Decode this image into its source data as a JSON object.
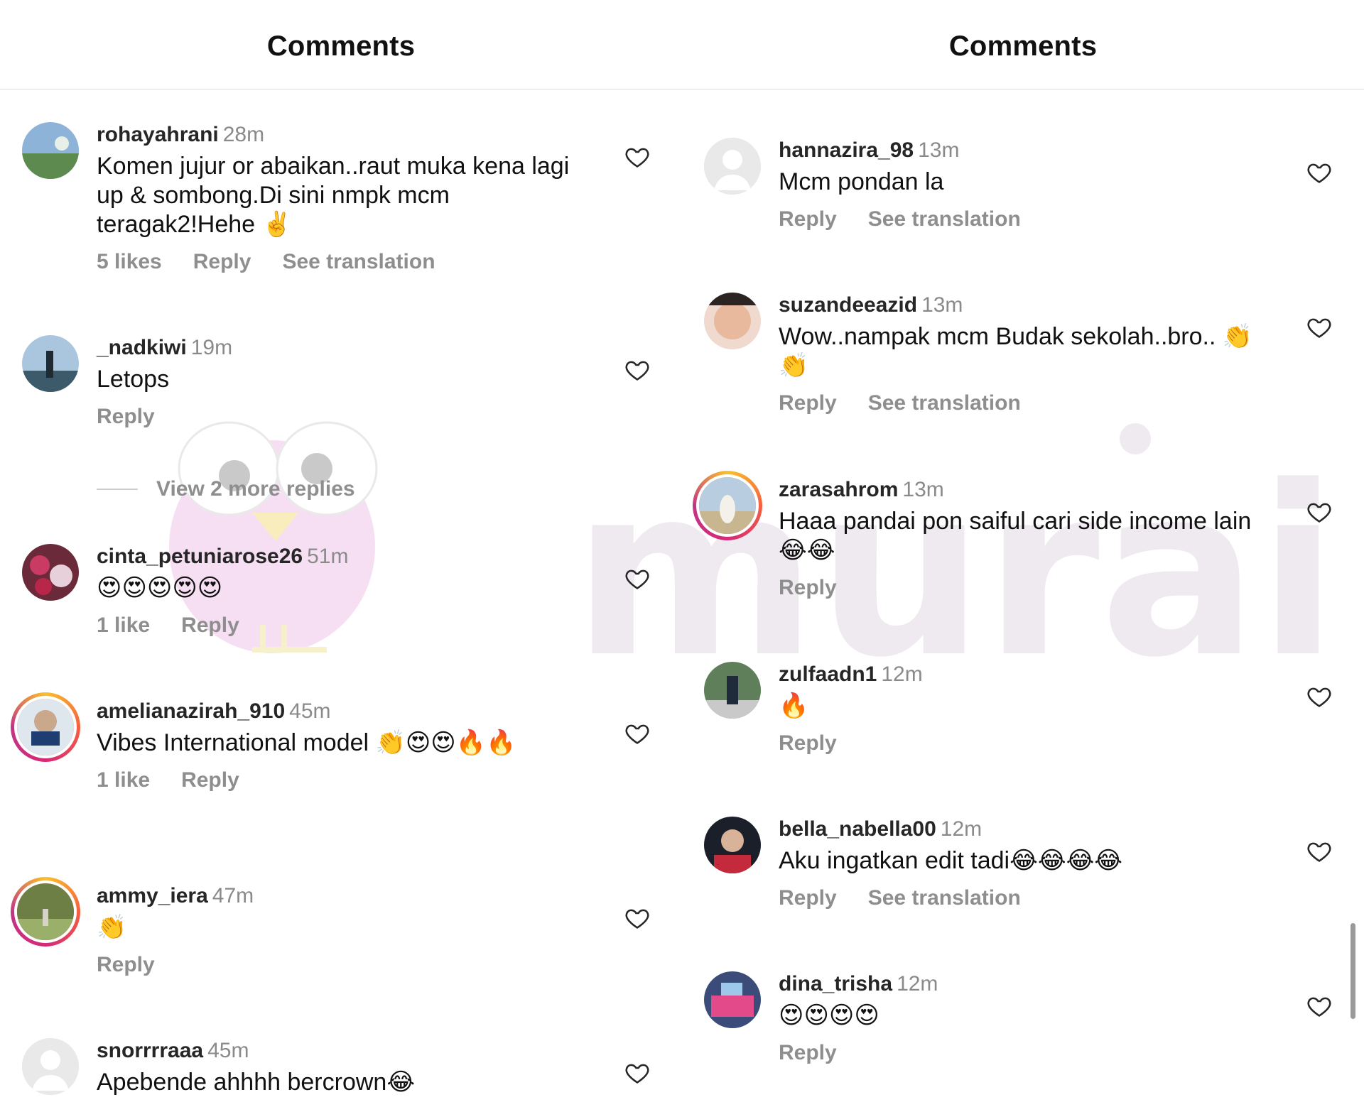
{
  "left": {
    "title": "Comments",
    "comments": [
      {
        "user": "rohayahrani",
        "time": "28m",
        "text": "Komen jujur or abaikan..raut muka kena lagi up & sombong.Di sini nmpk mcm teragak2!Hehe ✌️",
        "actions": [
          "5 likes",
          "Reply",
          "See translation"
        ]
      },
      {
        "user": "_nadkiwi",
        "time": "19m",
        "text": "Letops",
        "actions": [
          "Reply"
        ]
      },
      {
        "user": "cinta_petuniarose26",
        "time": "51m",
        "text": "😍😍😍😍😍",
        "actions": [
          "1 like",
          "Reply"
        ]
      },
      {
        "user": "amelianazirah_910",
        "time": "45m",
        "text": "Vibes International model 👏😍😍🔥🔥",
        "actions": [
          "1 like",
          "Reply"
        ]
      },
      {
        "user": "ammy_iera",
        "time": "47m",
        "text": "👏",
        "actions": [
          "Reply"
        ]
      },
      {
        "user": "snorrrraaa",
        "time": "45m",
        "text": "Apebende ahhhh bercrown😂",
        "actions": []
      }
    ],
    "view_more_replies": "View 2 more replies"
  },
  "right": {
    "title": "Comments",
    "comments": [
      {
        "user": "hannazira_98",
        "time": "13m",
        "text": "Mcm pondan la",
        "actions": [
          "Reply",
          "See translation"
        ]
      },
      {
        "user": "suzandeeazid",
        "time": "13m",
        "text": "Wow..nampak mcm Budak sekolah..bro.. 👏👏",
        "actions": [
          "Reply",
          "See translation"
        ]
      },
      {
        "user": "zarasahrom",
        "time": "13m",
        "text": "Haaa pandai pon saiful cari side income lain 😂😂",
        "actions": [
          "Reply"
        ]
      },
      {
        "user": "zulfaadn1",
        "time": "12m",
        "text": "🔥",
        "actions": [
          "Reply"
        ]
      },
      {
        "user": "bella_nabella00",
        "time": "12m",
        "text": "Aku ingatkan edit tadi😂😂😂😂",
        "actions": [
          "Reply",
          "See translation"
        ]
      },
      {
        "user": "dina_trisha",
        "time": "12m",
        "text": "😍😍😍😍",
        "actions": [
          "Reply"
        ]
      }
    ]
  },
  "watermark": {
    "brand": "murai",
    "color": "#e7dde6"
  }
}
